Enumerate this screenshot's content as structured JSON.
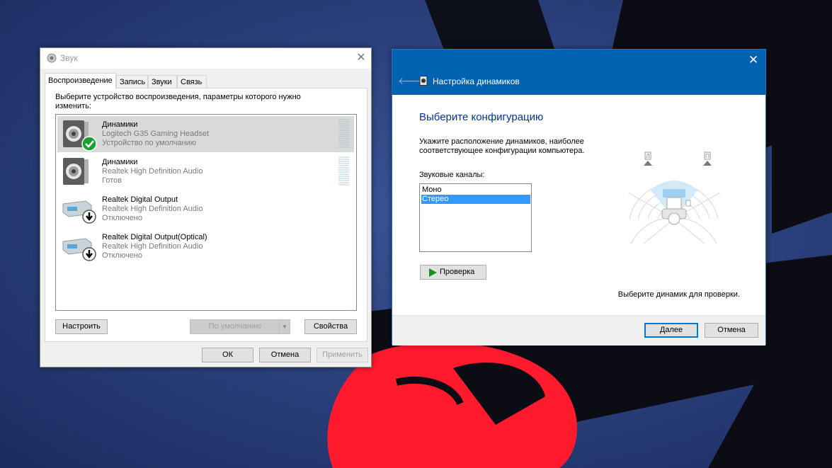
{
  "sound_dialog": {
    "title": "Звук",
    "tabs": [
      "Воспроизведение",
      "Запись",
      "Звуки",
      "Связь"
    ],
    "instruction": "Выберите устройство воспроизведения, параметры которого нужно изменить:",
    "devices": [
      {
        "name": "Динамики",
        "driver": "Logitech G35 Gaming Headset",
        "status": "Устройство по умолчанию",
        "selected": true,
        "icon": "speaker-default-icon"
      },
      {
        "name": "Динамики",
        "driver": "Realtek High Definition Audio",
        "status": "Готов",
        "selected": false,
        "icon": "speaker-icon"
      },
      {
        "name": "Realtek Digital Output",
        "driver": "Realtek High Definition Audio",
        "status": "Отключено",
        "selected": false,
        "icon": "digital-output-disabled-icon"
      },
      {
        "name": "Realtek Digital Output(Optical)",
        "driver": "Realtek High Definition Audio",
        "status": "Отключено",
        "selected": false,
        "icon": "digital-output-disabled-icon"
      }
    ],
    "buttons": {
      "configure": "Настроить",
      "set_default": "По умолчанию",
      "properties": "Свойства",
      "ok": "ОК",
      "cancel": "Отмена",
      "apply": "Применить"
    }
  },
  "speaker_setup": {
    "title": "Настройка динамиков",
    "heading": "Выберите конфигурацию",
    "description": "Укажите расположение динамиков, наиболее соответствующее конфигурации компьютера.",
    "channels_label": "Звуковые каналы:",
    "channels": [
      "Моно",
      "Стерео"
    ],
    "selected_channel": "Стерео",
    "test_button": "Проверка",
    "diagram_labels": {
      "left": "Л",
      "right": "П"
    },
    "hint": "Выберите динамик для проверки.",
    "next_button": "Далее",
    "cancel_button": "Отмена"
  },
  "colors": {
    "title_bar_blue": "#0063b1",
    "selection_blue": "#3399ff",
    "heading_blue": "#003399",
    "default_check_green": "#1aa032",
    "desktop_red": "#ff1a2e"
  }
}
